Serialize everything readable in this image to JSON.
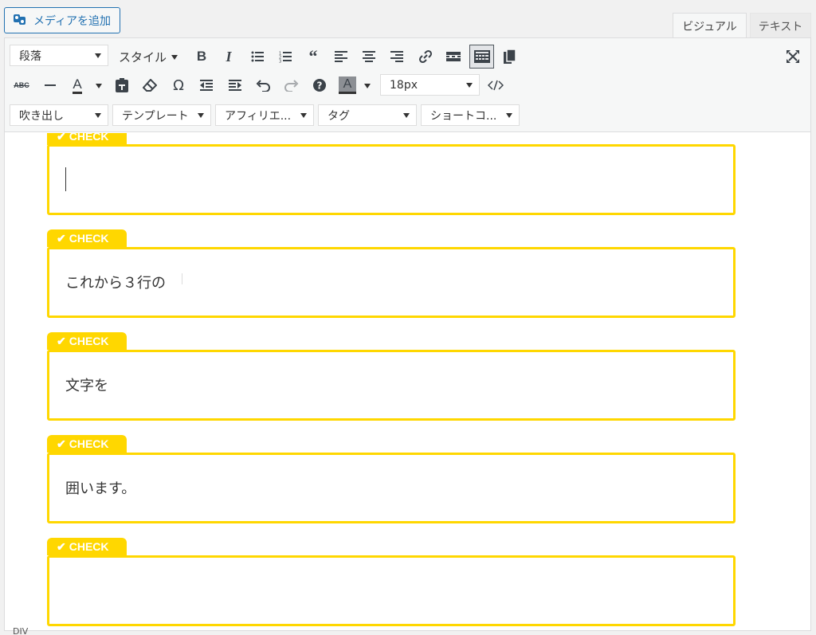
{
  "header": {
    "add_media_label": "メディアを追加",
    "tabs": [
      {
        "label": "ビジュアル",
        "active": true
      },
      {
        "label": "テキスト",
        "active": false
      }
    ]
  },
  "toolbar": {
    "row1": {
      "format_select": "段落",
      "style_menu": "スタイル"
    },
    "row2": {
      "font_size_select": "18px"
    },
    "row3": {
      "dropdowns": [
        "吹き出し",
        "テンプレート",
        "アフィリエ...",
        "タグ",
        "ショートコ..."
      ]
    }
  },
  "content": {
    "box_label": "CHECK",
    "boxes": [
      {
        "text": ""
      },
      {
        "text": "これから３行の"
      },
      {
        "text": "文字を"
      },
      {
        "text": "囲います。"
      },
      {
        "text": ""
      }
    ],
    "accent_color": "#ffd700"
  },
  "status": {
    "path": "DIV"
  }
}
